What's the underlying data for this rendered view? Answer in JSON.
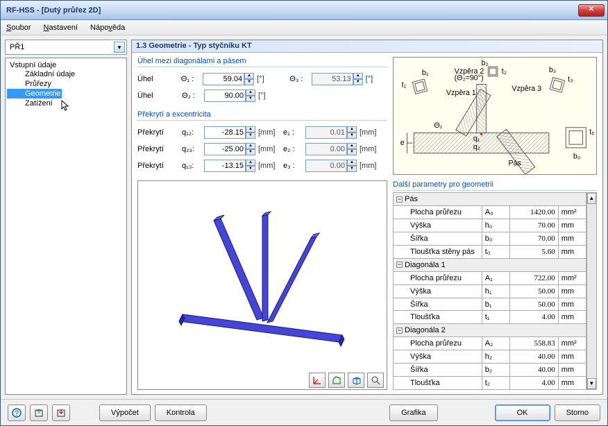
{
  "window": {
    "title": "RF-HSS - [Dutý průřez 2D]"
  },
  "menu": {
    "file": "Soubor",
    "settings": "Nastavení",
    "help": "Nápověda"
  },
  "combo": {
    "value": "PŘ1"
  },
  "tree": {
    "root": "Vstupní údaje",
    "items": [
      "Základní údaje",
      "Průřezy",
      "Geometrie",
      "Zatížení"
    ],
    "selected": 2
  },
  "panel_title": "1.3 Geometrie - Typ styčníku KT",
  "angles": {
    "title": "Úhel mezi diagonálami a pásem",
    "label": "Úhel",
    "deg": "[°]",
    "theta1": {
      "sym": "Θ₁ :",
      "val": "59.04"
    },
    "theta2": {
      "sym": "Θ₂ :",
      "val": "90.00"
    },
    "theta3": {
      "sym": "Θ₃ :",
      "val": "53.13"
    }
  },
  "overlap": {
    "title": "Překrytí a excentricita",
    "label": "Překrytí",
    "mm": "[mm]",
    "q12": {
      "sym": "q₁₂:",
      "val": "-28.15"
    },
    "q23": {
      "sym": "q₂₃:",
      "val": "-25.00"
    },
    "q13": {
      "sym": "q₁₃:",
      "val": "-13.15"
    },
    "e1": {
      "sym": "e₁ :",
      "val": "0.01"
    },
    "e2": {
      "sym": "e₂ :",
      "val": "0.00"
    },
    "e3": {
      "sym": "e₃ :",
      "val": "0.00"
    }
  },
  "schematic": {
    "labels": {
      "vz1": "Vzpěra 1",
      "vz2": "Vzpěra 2",
      "vz3": "Vzpěra 3",
      "pas": "Pás",
      "theta2_90": "(Θ₂=90°)"
    },
    "syms": {
      "t1": "t₁",
      "b1": "b₁",
      "t2": "t₂",
      "b2": "b₂",
      "t3": "t₃",
      "b3": "b₃",
      "t0": "t₀",
      "b0": "b₀",
      "theta1": "Θ₁",
      "e": "e",
      "q1": "q₁",
      "q2": "q₂"
    }
  },
  "params": {
    "title": "Další parametry pro geometrii",
    "groups": [
      {
        "name": "Pás",
        "rows": [
          {
            "lbl": "Plocha průřezu",
            "sym": "A₀",
            "val": "1420.00",
            "unit": "mm²"
          },
          {
            "lbl": "Výška",
            "sym": "h₀",
            "val": "70.00",
            "unit": "mm"
          },
          {
            "lbl": "Šířka",
            "sym": "b₀",
            "val": "70.00",
            "unit": "mm"
          },
          {
            "lbl": "Tloušťka stěny pás",
            "sym": "t₀",
            "val": "5.60",
            "unit": "mm"
          }
        ]
      },
      {
        "name": "Diagonála 1",
        "rows": [
          {
            "lbl": "Plocha průřezu",
            "sym": "A₁",
            "val": "722.00",
            "unit": "mm²"
          },
          {
            "lbl": "Výška",
            "sym": "h₁",
            "val": "50.00",
            "unit": "mm"
          },
          {
            "lbl": "Šířka",
            "sym": "b₁",
            "val": "50.00",
            "unit": "mm"
          },
          {
            "lbl": "Tloušťka",
            "sym": "t₁",
            "val": "4.00",
            "unit": "mm"
          }
        ]
      },
      {
        "name": "Diagonála 2",
        "rows": [
          {
            "lbl": "Plocha průřezu",
            "sym": "A₂",
            "val": "558.83",
            "unit": "mm²"
          },
          {
            "lbl": "Výška",
            "sym": "h₂",
            "val": "40.00",
            "unit": "mm"
          },
          {
            "lbl": "Šířka",
            "sym": "b₂",
            "val": "40.00",
            "unit": "mm"
          },
          {
            "lbl": "Tloušťka",
            "sym": "t₂",
            "val": "4.00",
            "unit": "mm"
          }
        ]
      }
    ]
  },
  "footer": {
    "calc": "Výpočet",
    "check": "Kontrola",
    "graphics": "Grafika",
    "ok": "OK",
    "cancel": "Storno"
  }
}
